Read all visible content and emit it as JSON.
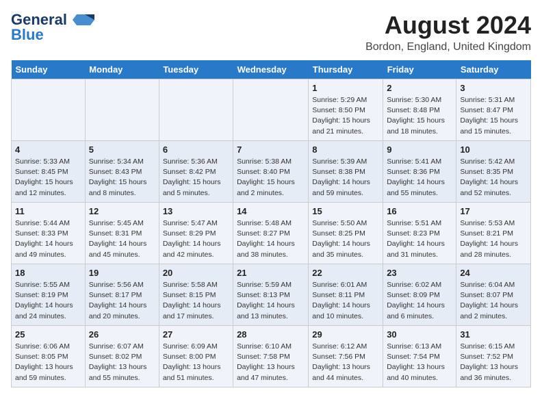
{
  "logo": {
    "line1": "General",
    "line2": "Blue"
  },
  "title": "August 2024",
  "subtitle": "Bordon, England, United Kingdom",
  "days_of_week": [
    "Sunday",
    "Monday",
    "Tuesday",
    "Wednesday",
    "Thursday",
    "Friday",
    "Saturday"
  ],
  "weeks": [
    [
      {
        "day": "",
        "info": ""
      },
      {
        "day": "",
        "info": ""
      },
      {
        "day": "",
        "info": ""
      },
      {
        "day": "",
        "info": ""
      },
      {
        "day": "1",
        "info": "Sunrise: 5:29 AM\nSunset: 8:50 PM\nDaylight: 15 hours\nand 21 minutes."
      },
      {
        "day": "2",
        "info": "Sunrise: 5:30 AM\nSunset: 8:48 PM\nDaylight: 15 hours\nand 18 minutes."
      },
      {
        "day": "3",
        "info": "Sunrise: 5:31 AM\nSunset: 8:47 PM\nDaylight: 15 hours\nand 15 minutes."
      }
    ],
    [
      {
        "day": "4",
        "info": "Sunrise: 5:33 AM\nSunset: 8:45 PM\nDaylight: 15 hours\nand 12 minutes."
      },
      {
        "day": "5",
        "info": "Sunrise: 5:34 AM\nSunset: 8:43 PM\nDaylight: 15 hours\nand 8 minutes."
      },
      {
        "day": "6",
        "info": "Sunrise: 5:36 AM\nSunset: 8:42 PM\nDaylight: 15 hours\nand 5 minutes."
      },
      {
        "day": "7",
        "info": "Sunrise: 5:38 AM\nSunset: 8:40 PM\nDaylight: 15 hours\nand 2 minutes."
      },
      {
        "day": "8",
        "info": "Sunrise: 5:39 AM\nSunset: 8:38 PM\nDaylight: 14 hours\nand 59 minutes."
      },
      {
        "day": "9",
        "info": "Sunrise: 5:41 AM\nSunset: 8:36 PM\nDaylight: 14 hours\nand 55 minutes."
      },
      {
        "day": "10",
        "info": "Sunrise: 5:42 AM\nSunset: 8:35 PM\nDaylight: 14 hours\nand 52 minutes."
      }
    ],
    [
      {
        "day": "11",
        "info": "Sunrise: 5:44 AM\nSunset: 8:33 PM\nDaylight: 14 hours\nand 49 minutes."
      },
      {
        "day": "12",
        "info": "Sunrise: 5:45 AM\nSunset: 8:31 PM\nDaylight: 14 hours\nand 45 minutes."
      },
      {
        "day": "13",
        "info": "Sunrise: 5:47 AM\nSunset: 8:29 PM\nDaylight: 14 hours\nand 42 minutes."
      },
      {
        "day": "14",
        "info": "Sunrise: 5:48 AM\nSunset: 8:27 PM\nDaylight: 14 hours\nand 38 minutes."
      },
      {
        "day": "15",
        "info": "Sunrise: 5:50 AM\nSunset: 8:25 PM\nDaylight: 14 hours\nand 35 minutes."
      },
      {
        "day": "16",
        "info": "Sunrise: 5:51 AM\nSunset: 8:23 PM\nDaylight: 14 hours\nand 31 minutes."
      },
      {
        "day": "17",
        "info": "Sunrise: 5:53 AM\nSunset: 8:21 PM\nDaylight: 14 hours\nand 28 minutes."
      }
    ],
    [
      {
        "day": "18",
        "info": "Sunrise: 5:55 AM\nSunset: 8:19 PM\nDaylight: 14 hours\nand 24 minutes."
      },
      {
        "day": "19",
        "info": "Sunrise: 5:56 AM\nSunset: 8:17 PM\nDaylight: 14 hours\nand 20 minutes."
      },
      {
        "day": "20",
        "info": "Sunrise: 5:58 AM\nSunset: 8:15 PM\nDaylight: 14 hours\nand 17 minutes."
      },
      {
        "day": "21",
        "info": "Sunrise: 5:59 AM\nSunset: 8:13 PM\nDaylight: 14 hours\nand 13 minutes."
      },
      {
        "day": "22",
        "info": "Sunrise: 6:01 AM\nSunset: 8:11 PM\nDaylight: 14 hours\nand 10 minutes."
      },
      {
        "day": "23",
        "info": "Sunrise: 6:02 AM\nSunset: 8:09 PM\nDaylight: 14 hours\nand 6 minutes."
      },
      {
        "day": "24",
        "info": "Sunrise: 6:04 AM\nSunset: 8:07 PM\nDaylight: 14 hours\nand 2 minutes."
      }
    ],
    [
      {
        "day": "25",
        "info": "Sunrise: 6:06 AM\nSunset: 8:05 PM\nDaylight: 13 hours\nand 59 minutes."
      },
      {
        "day": "26",
        "info": "Sunrise: 6:07 AM\nSunset: 8:02 PM\nDaylight: 13 hours\nand 55 minutes."
      },
      {
        "day": "27",
        "info": "Sunrise: 6:09 AM\nSunset: 8:00 PM\nDaylight: 13 hours\nand 51 minutes."
      },
      {
        "day": "28",
        "info": "Sunrise: 6:10 AM\nSunset: 7:58 PM\nDaylight: 13 hours\nand 47 minutes."
      },
      {
        "day": "29",
        "info": "Sunrise: 6:12 AM\nSunset: 7:56 PM\nDaylight: 13 hours\nand 44 minutes."
      },
      {
        "day": "30",
        "info": "Sunrise: 6:13 AM\nSunset: 7:54 PM\nDaylight: 13 hours\nand 40 minutes."
      },
      {
        "day": "31",
        "info": "Sunrise: 6:15 AM\nSunset: 7:52 PM\nDaylight: 13 hours\nand 36 minutes."
      }
    ]
  ]
}
